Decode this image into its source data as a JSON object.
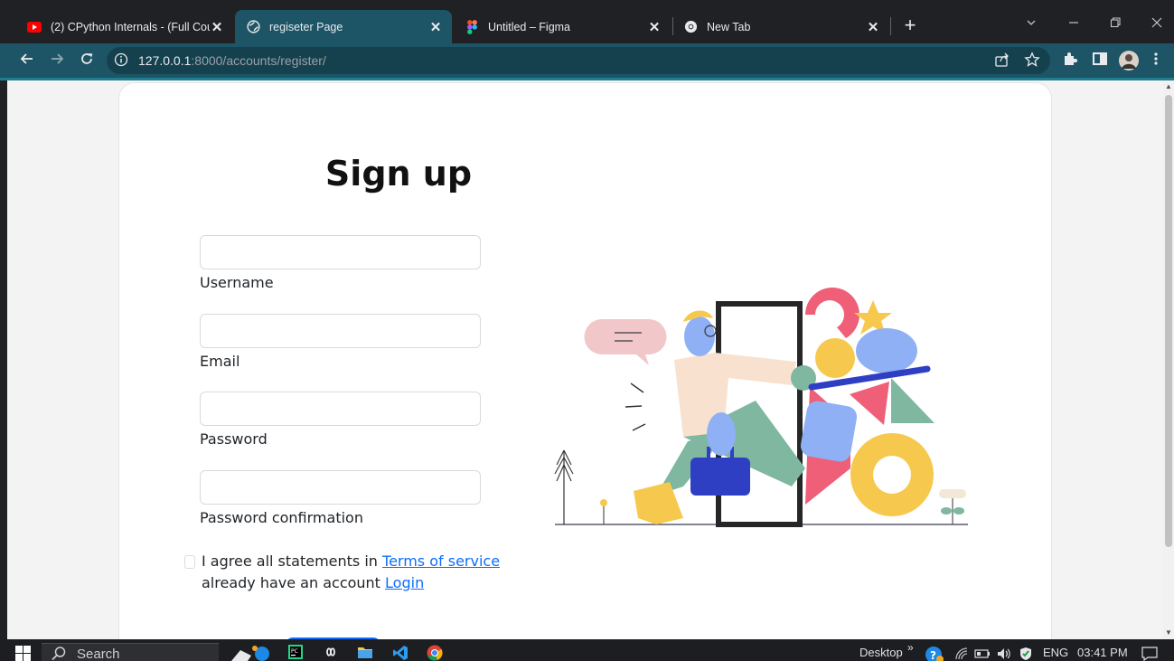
{
  "browser": {
    "tabs": [
      {
        "title": "(2) CPython Internals - (Full Cour",
        "active": false
      },
      {
        "title": "regiseter Page",
        "active": true
      },
      {
        "title": "Untitled – Figma",
        "active": false
      },
      {
        "title": "New Tab",
        "active": false
      }
    ],
    "url_host": "127.0.0.1",
    "url_rest": ":8000/accounts/register/"
  },
  "page": {
    "heading": "Sign up",
    "fields": {
      "username": {
        "label": "Username",
        "value": ""
      },
      "email": {
        "label": "Email",
        "value": ""
      },
      "password": {
        "label": "Password",
        "value": ""
      },
      "password_confirmation": {
        "label": "Password confirmation",
        "value": ""
      }
    },
    "agree_text": "I agree all statements in ",
    "terms_link": "Terms of service",
    "account_text": "already have an account ",
    "login_link": "Login"
  },
  "taskbar": {
    "search_label": "Search",
    "desktop_label": "Desktop",
    "chevrons": "»",
    "language": "ENG",
    "time": "03:41 PM"
  },
  "colors": {
    "tab_active": "#1d5566",
    "link": "#0d6efd",
    "illus_yellow": "#f6c94e",
    "illus_blue": "#8fb0f5",
    "illus_pink": "#ef5f78",
    "illus_green": "#7fb7a0",
    "illus_navy": "#2f3fc4"
  }
}
